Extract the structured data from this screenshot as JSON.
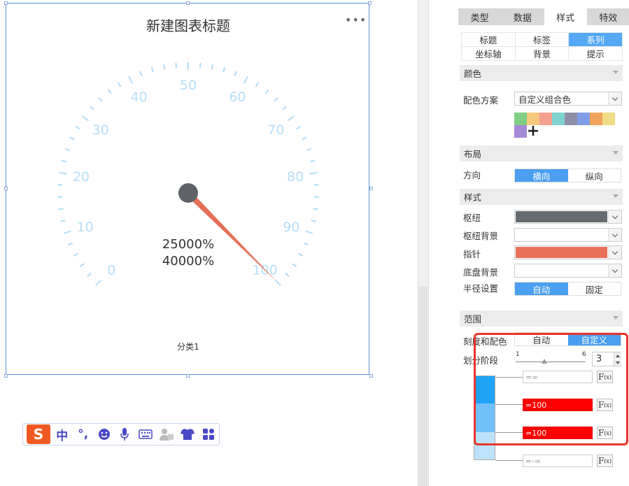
{
  "chart": {
    "title": "新建图表标题",
    "more_icon": "more-dots-icon",
    "category_label": "分类1"
  },
  "chart_data": {
    "type": "gauge",
    "tick_labels": [
      "0",
      "10",
      "20",
      "30",
      "40",
      "50",
      "60",
      "70",
      "80",
      "90",
      "100"
    ],
    "min": 0,
    "max": 100,
    "pointer_value": 100,
    "value_labels": [
      "25000%",
      "40000%"
    ],
    "category": "分类1",
    "colors": {
      "tick": "#b7def5",
      "hub": "#5f6367",
      "pointer": "#e57056"
    }
  },
  "panel": {
    "top_tabs": [
      {
        "label": "类型",
        "active": false
      },
      {
        "label": "数据",
        "active": false
      },
      {
        "label": "样式",
        "active": true
      },
      {
        "label": "特效",
        "active": false
      }
    ],
    "sub_tabs": [
      {
        "label": "标题",
        "active": false
      },
      {
        "label": "标签",
        "active": false
      },
      {
        "label": "系列",
        "active": true
      },
      {
        "label": "坐标轴",
        "active": false
      },
      {
        "label": "背景",
        "active": false
      },
      {
        "label": "提示",
        "active": false
      }
    ],
    "color_section": {
      "title": "颜色",
      "scheme_label": "配色方案",
      "scheme_value": "自定义组合色",
      "swatches": [
        "#7fcf85",
        "#f6c97c",
        "#f59f8e",
        "#7fd3cf",
        "#8e8fa8",
        "#7f9de8",
        "#f2a35c",
        "#efdc85",
        "#a58ad6"
      ],
      "add_icon": "plus-icon"
    },
    "layout_section": {
      "title": "布局",
      "direction_label": "方向",
      "direction_options": [
        "横向",
        "纵向"
      ],
      "direction_selected": "横向"
    },
    "style_section": {
      "title": "样式",
      "hub_label": "枢纽",
      "hub_color": "#666b70",
      "hub_bg_label": "枢纽背景",
      "pointer_label": "指针",
      "pointer_color": "#e87259",
      "dial_bg_label": "底盘背景",
      "radius_label": "半径设置",
      "radius_options": [
        "自动",
        "固定"
      ],
      "radius_selected": "自动"
    },
    "range_section": {
      "title": "范围",
      "scale_color_label": "刻度和配色",
      "scale_options": [
        "自动",
        "自定义"
      ],
      "scale_selected": "自定义",
      "stage_label": "划分阶段",
      "slider_min": "1",
      "slider_max": "6",
      "stage_value": "3",
      "bounds": [
        {
          "text": "=∞",
          "highlighted": false
        },
        {
          "text": "=100",
          "highlighted": true
        },
        {
          "text": "=100",
          "highlighted": true
        },
        {
          "text": "=-∞",
          "highlighted": false
        }
      ],
      "band_colors": [
        "#1fa3f7",
        "#70c1f9",
        "#bde2fb"
      ],
      "fx_label": "F",
      "fx_sub": "(x)"
    }
  },
  "ime_toolbar": {
    "logo_letter": "S",
    "items": [
      {
        "name": "chinese-mode-icon",
        "label": "中"
      },
      {
        "name": "punctuation-icon",
        "label": "°,"
      },
      {
        "name": "emoji-icon",
        "label": ""
      },
      {
        "name": "microphone-icon",
        "label": ""
      },
      {
        "name": "keyboard-icon",
        "label": ""
      },
      {
        "name": "account-icon",
        "label": ""
      },
      {
        "name": "skin-icon",
        "label": ""
      },
      {
        "name": "toolbox-icon",
        "label": ""
      }
    ]
  }
}
